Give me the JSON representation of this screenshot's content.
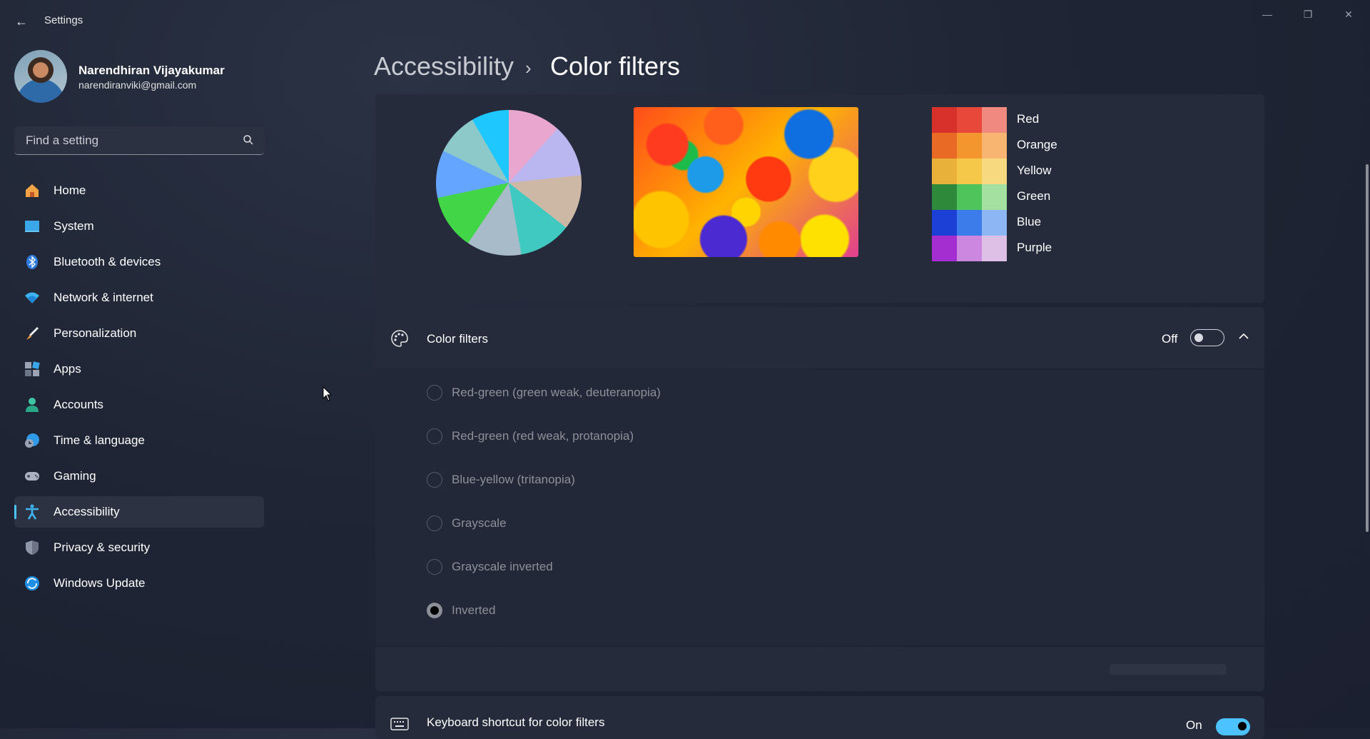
{
  "window": {
    "title": "Settings",
    "controls": {
      "minimize": "—",
      "maximize": "❐",
      "close": "✕"
    }
  },
  "profile": {
    "name": "Narendhiran Vijayakumar",
    "email": "narendiranviki@gmail.com"
  },
  "search": {
    "placeholder": "Find a setting"
  },
  "sidebar": {
    "items": [
      {
        "label": "Home",
        "icon": "home-icon"
      },
      {
        "label": "System",
        "icon": "system-icon"
      },
      {
        "label": "Bluetooth & devices",
        "icon": "bluetooth-icon"
      },
      {
        "label": "Network & internet",
        "icon": "wifi-icon"
      },
      {
        "label": "Personalization",
        "icon": "brush-icon"
      },
      {
        "label": "Apps",
        "icon": "apps-icon"
      },
      {
        "label": "Accounts",
        "icon": "accounts-icon"
      },
      {
        "label": "Time & language",
        "icon": "clock-icon"
      },
      {
        "label": "Gaming",
        "icon": "controller-icon"
      },
      {
        "label": "Accessibility",
        "icon": "accessibility-icon",
        "active": true
      },
      {
        "label": "Privacy & security",
        "icon": "shield-icon"
      },
      {
        "label": "Windows Update",
        "icon": "update-icon"
      }
    ]
  },
  "breadcrumb": {
    "parent": "Accessibility",
    "separator": "›",
    "current": "Color filters"
  },
  "preview": {
    "swatches": [
      {
        "label": "Red",
        "colors": [
          "#d8302a",
          "#e8483a",
          "#f08a80"
        ]
      },
      {
        "label": "Orange",
        "colors": [
          "#e86a25",
          "#f4962e",
          "#f8b572"
        ]
      },
      {
        "label": "Yellow",
        "colors": [
          "#e8b23a",
          "#f6c84a",
          "#f7da80"
        ]
      },
      {
        "label": "Green",
        "colors": [
          "#2e8a3a",
          "#4ec45a",
          "#a4e0a0"
        ]
      },
      {
        "label": "Blue",
        "colors": [
          "#1c3fd6",
          "#3b7bea",
          "#8db6f4"
        ]
      },
      {
        "label": "Purple",
        "colors": [
          "#a42ed0",
          "#cc88e0",
          "#dec0e6"
        ]
      }
    ]
  },
  "color_filters": {
    "title": "Color filters",
    "state": "Off",
    "enabled": false,
    "options": [
      {
        "label": "Red-green (green weak, deuteranopia)",
        "selected": false
      },
      {
        "label": "Red-green (red weak, protanopia)",
        "selected": false
      },
      {
        "label": "Blue-yellow (tritanopia)",
        "selected": false
      },
      {
        "label": "Grayscale",
        "selected": false
      },
      {
        "label": "Grayscale inverted",
        "selected": false
      },
      {
        "label": "Inverted",
        "selected": true
      }
    ]
  },
  "keyboard_shortcut": {
    "title": "Keyboard shortcut for color filters",
    "state": "On",
    "enabled": true
  },
  "colors": {
    "accent": "#4cc2ff",
    "card": "#252b3a",
    "background": "#1f2534"
  }
}
